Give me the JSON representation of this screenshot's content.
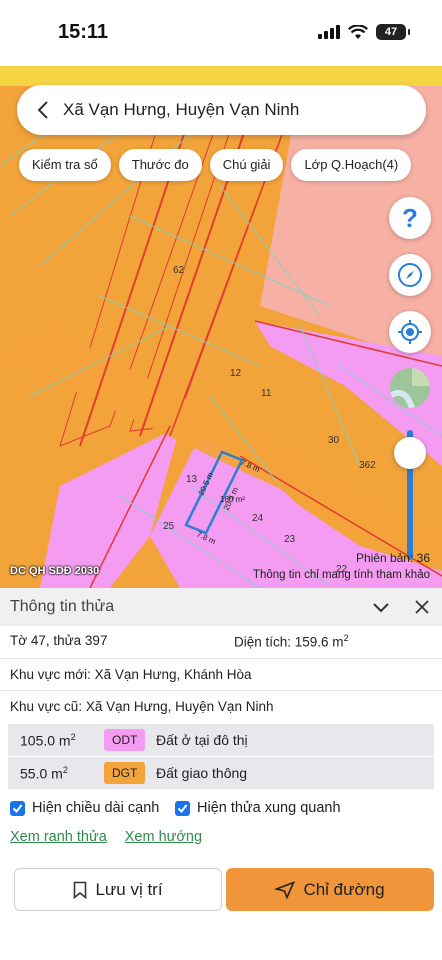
{
  "status_bar": {
    "time": "15:11",
    "battery": "47"
  },
  "search": {
    "title": "Xã Vạn Hưng, Huyện Vạn Ninh"
  },
  "chips": [
    "Kiểm tra sổ",
    "Thước đo",
    "Chú giải",
    "Lớp Q.Hoạch(4)"
  ],
  "map": {
    "parcel_labels": [
      "62",
      "12",
      "11",
      "30",
      "362",
      "13",
      "25",
      "24",
      "23",
      "22"
    ],
    "edge_labels": [
      "20.5 m",
      "7.8 m",
      "160 m²",
      "20.5 m",
      "7.8 m"
    ],
    "layer_label": "DC QH SDĐ 2030",
    "version": "Phiên bản: 36",
    "disclaimer": "Thông tin chỉ mang tính tham khảo",
    "colors": {
      "road": "#f2a33a",
      "residential": "#f49cf2",
      "agri": "#f7b0a4",
      "boundary": "#e23b2e"
    }
  },
  "panel": {
    "title": "Thông tin thửa",
    "sheet_parcel": "Tờ 47, thửa 397",
    "area_label": "Diện tích: 159.6 m",
    "area_sup": "2",
    "new_area": "Khu vực mới:  Xã Vạn Hưng, Khánh Hòa",
    "old_area": "Khu vực cũ:  Xã Vạn Hưng, Huyện Vạn Ninh",
    "zones": [
      {
        "area": "105.0 m",
        "sup": "2",
        "code": "ODT",
        "color": "#f49cf2",
        "desc": "Đất ở tại đô thị"
      },
      {
        "area": "55.0 m",
        "sup": "2",
        "code": "DGT",
        "color": "#f2a33a",
        "desc": "Đất giao thông"
      }
    ],
    "check_edges": "Hiện chiều dài cạnh",
    "check_neighbors": "Hiện thửa xung quanh",
    "link_bounds": "Xem ranh thửa",
    "link_direction": "Xem hướng",
    "btn_save": "Lưu vị trí",
    "btn_route": "Chỉ đường"
  }
}
